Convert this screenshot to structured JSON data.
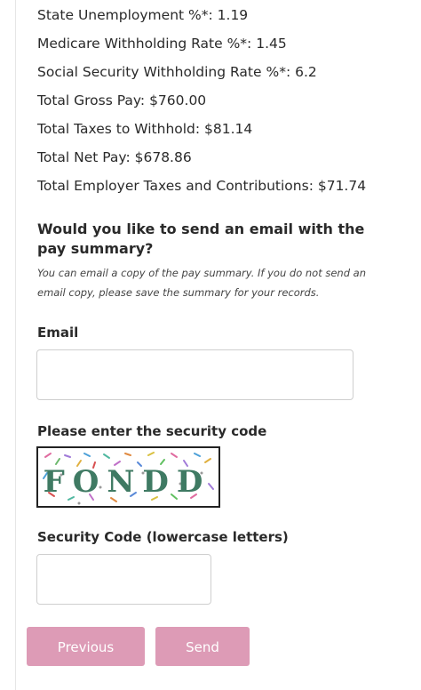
{
  "summary": {
    "state_unemployment": "State Unemployment %*: 1.19",
    "medicare_rate": "Medicare Withholding Rate %*: 1.45",
    "social_security_rate": "Social Security Withholding Rate %*: 6.2",
    "total_gross_pay": "Total Gross Pay: $760.00",
    "total_taxes": "Total Taxes to Withhold: $81.14",
    "total_net_pay": "Total Net Pay: $678.86",
    "total_employer": "Total Employer Taxes and Contributions: $71.74"
  },
  "email_section": {
    "heading": "Would you like to send an email with the pay summary?",
    "note": "You can email a copy of the pay summary. If you do not send an email copy, please save the summary for your records.",
    "email_label": "Email",
    "email_value": ""
  },
  "security": {
    "heading": "Please enter the security code",
    "captcha_text": "FONDD",
    "code_label": "Security Code (lowercase letters)",
    "code_value": ""
  },
  "buttons": {
    "previous_label": "Previous",
    "send_label": "Send"
  },
  "colors": {
    "button_bg": "#dd9bb6",
    "captcha_text": "#3f7a63"
  },
  "icons": {
    "captcha": "captcha-image"
  }
}
